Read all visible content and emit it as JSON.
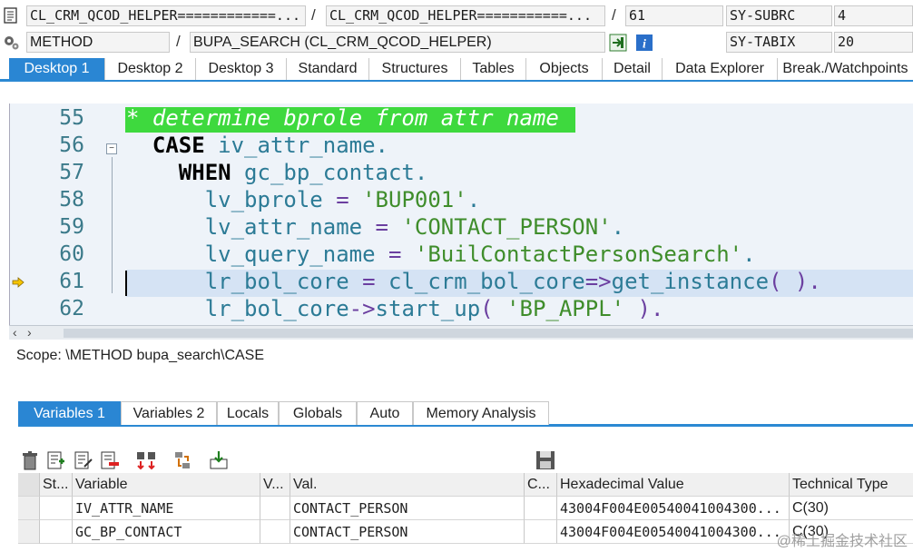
{
  "header": {
    "row1": {
      "program": "CL_CRM_QCOD_HELPER============...",
      "include": "CL_CRM_QCOD_HELPER===========...",
      "line": "61",
      "sysvar_name": "SY-SUBRC",
      "sysvar_value": "4"
    },
    "row2": {
      "event_type": "METHOD",
      "event_name": "BUPA_SEARCH (CL_CRM_QCOD_HELPER)",
      "sysvar_name": "SY-TABIX",
      "sysvar_value": "20"
    },
    "separator": "/"
  },
  "desktop_tabs": [
    "Desktop 1",
    "Desktop 2",
    "Desktop 3",
    "Standard",
    "Structures",
    "Tables",
    "Objects",
    "Detail",
    "Data Explorer",
    "Break./Watchpoints"
  ],
  "editor": {
    "lines": [
      {
        "no": "55",
        "parts": [
          {
            "t": "* determine bprole from attr name",
            "c": "cm"
          }
        ]
      },
      {
        "no": "56",
        "parts": [
          {
            "t": "  ",
            "c": ""
          },
          {
            "t": "CASE",
            "c": "kw"
          },
          {
            "t": " iv_attr_name.",
            "c": ""
          }
        ]
      },
      {
        "no": "57",
        "parts": [
          {
            "t": "    ",
            "c": ""
          },
          {
            "t": "WHEN",
            "c": "kw"
          },
          {
            "t": " gc_bp_contact.",
            "c": ""
          }
        ]
      },
      {
        "no": "58",
        "parts": [
          {
            "t": "      lv_bprole ",
            "c": ""
          },
          {
            "t": "=",
            "c": "op"
          },
          {
            "t": " ",
            "c": ""
          },
          {
            "t": "'BUP001'",
            "c": "str"
          },
          {
            "t": ".",
            "c": ""
          }
        ]
      },
      {
        "no": "59",
        "parts": [
          {
            "t": "      lv_attr_name ",
            "c": ""
          },
          {
            "t": "=",
            "c": "op"
          },
          {
            "t": " ",
            "c": ""
          },
          {
            "t": "'CONTACT_PERSON'",
            "c": "str"
          },
          {
            "t": ".",
            "c": ""
          }
        ]
      },
      {
        "no": "60",
        "parts": [
          {
            "t": "      lv_query_name ",
            "c": ""
          },
          {
            "t": "=",
            "c": "op"
          },
          {
            "t": " ",
            "c": ""
          },
          {
            "t": "'BuilContactPersonSearch'",
            "c": "str"
          },
          {
            "t": ".",
            "c": ""
          }
        ]
      },
      {
        "no": "61",
        "parts": [
          {
            "t": "      lr_bol_core ",
            "c": ""
          },
          {
            "t": "=",
            "c": "op"
          },
          {
            "t": " cl_crm_bol_core",
            "c": ""
          },
          {
            "t": "=>",
            "c": "op"
          },
          {
            "t": "get_instance",
            "c": ""
          },
          {
            "t": "( ).",
            "c": "op"
          }
        ]
      },
      {
        "no": "62",
        "parts": [
          {
            "t": "      lr_bol_core",
            "c": ""
          },
          {
            "t": "->",
            "c": "op"
          },
          {
            "t": "start_up",
            "c": ""
          },
          {
            "t": "( ",
            "c": "op"
          },
          {
            "t": "'BP_APPL'",
            "c": "str"
          },
          {
            "t": " ).",
            "c": "op"
          }
        ]
      }
    ],
    "current_line": "61"
  },
  "scope": "Scope: \\METHOD bupa_search\\CASE",
  "variable_tabs": [
    "Variables 1",
    "Variables 2",
    "Locals",
    "Globals",
    "Auto",
    "Memory Analysis"
  ],
  "grid": {
    "columns": [
      "St...",
      "Variable",
      "V...",
      "Val.",
      "C...",
      "Hexadecimal Value",
      "Technical Type"
    ],
    "rows": [
      [
        "",
        "IV_ATTR_NAME",
        "",
        "CONTACT_PERSON",
        "",
        "43004F004E00540041004300...",
        "C(30)"
      ],
      [
        "",
        "GC_BP_CONTACT",
        "",
        "CONTACT_PERSON",
        "",
        "43004F004E00540041004300...",
        "C(30)"
      ]
    ]
  },
  "watermark": "@稀土掘金技术社区",
  "colors": {
    "accent": "#2a86d3",
    "comment_bg": "#3ed93e",
    "current_line": "#d5e3f4"
  }
}
